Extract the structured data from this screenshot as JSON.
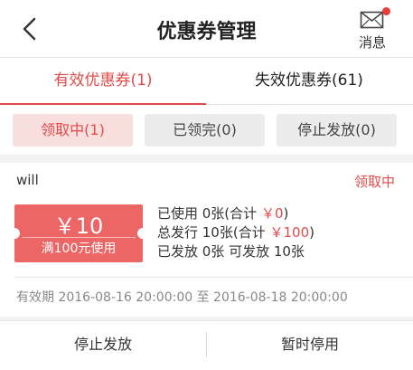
{
  "header": {
    "title": "优惠券管理",
    "message_label": "消息",
    "back_icon": "chevron-left-icon",
    "message_icon": "envelope-icon",
    "badge_color": "#e63c3c"
  },
  "tabs": [
    {
      "label": "有效优惠券(1)",
      "active": true
    },
    {
      "label": "失效优惠券(61)",
      "active": false
    }
  ],
  "filters": [
    {
      "label": "领取中(1)",
      "active": true
    },
    {
      "label": "已领完(0)",
      "active": false
    },
    {
      "label": "停止发放(0)",
      "active": false
    }
  ],
  "coupon": {
    "name": "will",
    "status": "领取中",
    "amount": "￥10",
    "condition": "满100元使用",
    "used_prefix": "已使用 0张(合计 ",
    "used_total": "￥0",
    "used_suffix": ")",
    "issued_prefix": "总发行 10张(合计 ",
    "issued_total": "￥100",
    "issued_suffix": ")",
    "distributed": "已发放 0张 可发放 10张",
    "validity": "有效期 2016-08-16 20:00:00 至 2016-08-18 20:00:00"
  },
  "actions": {
    "stop": "停止发放",
    "pause": "暂时停用"
  },
  "colors": {
    "accent": "#e04b4b",
    "ticket": "#ec6666"
  }
}
